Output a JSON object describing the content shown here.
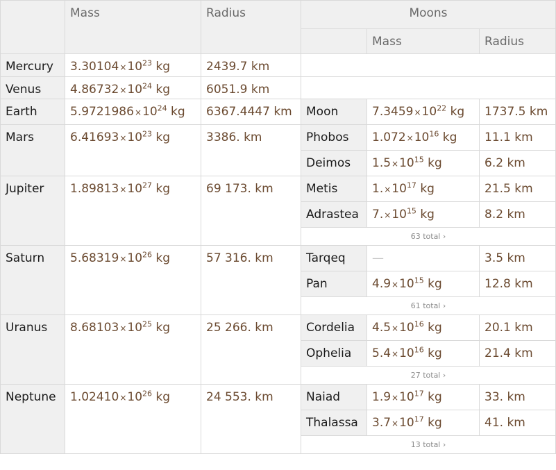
{
  "header": {
    "mass": "Mass",
    "radius": "Radius",
    "moons": "Moons",
    "moon_mass": "Mass",
    "moon_radius": "Radius"
  },
  "colors": {
    "border": "#d9d9d9",
    "header_bg": "#f0f0f0",
    "body_bg": "#ffffff",
    "value_text": "#6b4a30"
  },
  "planets": [
    {
      "name": "Mercury",
      "mass": {
        "mantissa": "3.30104",
        "exponent": "23",
        "unit": "kg"
      },
      "radius": "2439.7 km",
      "moons": []
    },
    {
      "name": "Venus",
      "mass": {
        "mantissa": "4.86732",
        "exponent": "24",
        "unit": "kg"
      },
      "radius": "6051.9 km",
      "moons": []
    },
    {
      "name": "Earth",
      "mass": {
        "mantissa": "5.9721986",
        "exponent": "24",
        "unit": "kg"
      },
      "radius": "6367.4447 km",
      "moons": [
        {
          "name": "Moon",
          "mass": {
            "mantissa": "7.3459",
            "exponent": "22",
            "unit": "kg"
          },
          "radius": "1737.5 km"
        }
      ]
    },
    {
      "name": "Mars",
      "mass": {
        "mantissa": "6.41693",
        "exponent": "23",
        "unit": "kg"
      },
      "radius": "3386. km",
      "moons": [
        {
          "name": "Phobos",
          "mass": {
            "mantissa": "1.072",
            "exponent": "16",
            "unit": "kg"
          },
          "radius": "11.1 km"
        },
        {
          "name": "Deimos",
          "mass": {
            "mantissa": "1.5",
            "exponent": "15",
            "unit": "kg"
          },
          "radius": "6.2 km"
        }
      ]
    },
    {
      "name": "Jupiter",
      "mass": {
        "mantissa": "1.89813",
        "exponent": "27",
        "unit": "kg"
      },
      "radius": "69 173. km",
      "moons": [
        {
          "name": "Metis",
          "mass": {
            "mantissa": "1.",
            "exponent": "17",
            "unit": "kg"
          },
          "radius": "21.5 km"
        },
        {
          "name": "Adrastea",
          "mass": {
            "mantissa": "7.",
            "exponent": "15",
            "unit": "kg"
          },
          "radius": "8.2 km"
        }
      ],
      "total": "63 total ›"
    },
    {
      "name": "Saturn",
      "mass": {
        "mantissa": "5.68319",
        "exponent": "26",
        "unit": "kg"
      },
      "radius": "57 316. km",
      "moons": [
        {
          "name": "Tarqeq",
          "mass": null,
          "mass_missing": "—",
          "radius": "3.5 km"
        },
        {
          "name": "Pan",
          "mass": {
            "mantissa": "4.9",
            "exponent": "15",
            "unit": "kg"
          },
          "radius": "12.8 km"
        }
      ],
      "total": "61 total ›"
    },
    {
      "name": "Uranus",
      "mass": {
        "mantissa": "8.68103",
        "exponent": "25",
        "unit": "kg"
      },
      "radius": "25 266. km",
      "moons": [
        {
          "name": "Cordelia",
          "mass": {
            "mantissa": "4.5",
            "exponent": "16",
            "unit": "kg"
          },
          "radius": "20.1 km"
        },
        {
          "name": "Ophelia",
          "mass": {
            "mantissa": "5.4",
            "exponent": "16",
            "unit": "kg"
          },
          "radius": "21.4 km"
        }
      ],
      "total": "27 total ›"
    },
    {
      "name": "Neptune",
      "mass": {
        "mantissa": "1.02410",
        "exponent": "26",
        "unit": "kg"
      },
      "radius": "24 553. km",
      "moons": [
        {
          "name": "Naiad",
          "mass": {
            "mantissa": "1.9",
            "exponent": "17",
            "unit": "kg"
          },
          "radius": "33. km"
        },
        {
          "name": "Thalassa",
          "mass": {
            "mantissa": "3.7",
            "exponent": "17",
            "unit": "kg"
          },
          "radius": "41. km"
        }
      ],
      "total": "13 total ›"
    }
  ]
}
